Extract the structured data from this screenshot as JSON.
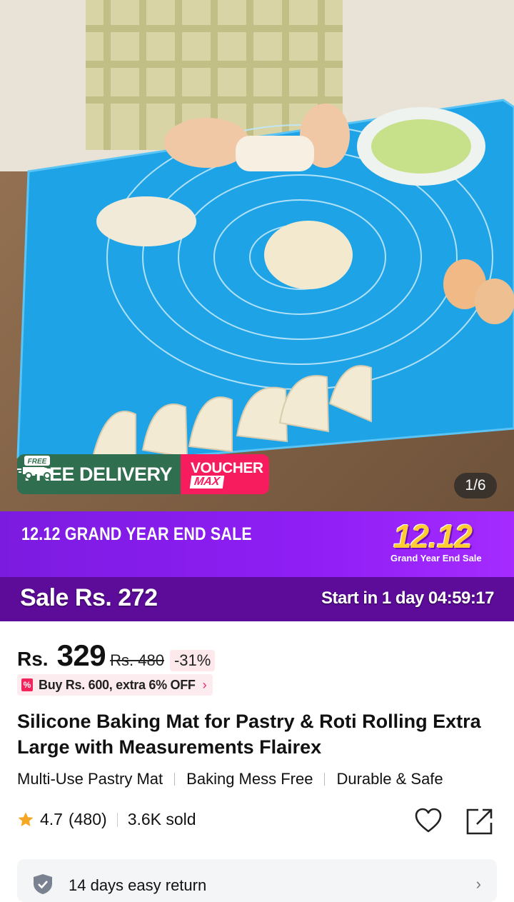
{
  "gallery": {
    "counter": "1/6",
    "badges": {
      "free_small": "FREE",
      "free_delivery": "FREE DELIVERY",
      "voucher_top": "VOUCHER",
      "voucher_bottom": "MAX"
    }
  },
  "campaign": {
    "title": "12.12 GRAND YEAR END SALE",
    "logo_big": "12.12",
    "logo_small": "Grand Year End Sale"
  },
  "sale": {
    "price_text": "Sale Rs. 272",
    "countdown_text": "Start in 1 day 04:59:17"
  },
  "price": {
    "currency": "Rs.",
    "amount": "329",
    "original": "Rs. 480",
    "discount": "-31%"
  },
  "promo": {
    "text": "Buy Rs. 600, extra 6% OFF",
    "chevron": "›"
  },
  "product": {
    "title": "Silicone Baking Mat for Pastry & Roti Rolling Extra Large with Measurements Flairex",
    "features": [
      "Multi-Use Pastry Mat",
      "Baking Mess Free",
      "Durable & Safe"
    ],
    "rating": "4.7",
    "reviews": "(480)",
    "sold": "3.6K sold"
  },
  "return_policy": {
    "text": "14 days easy return",
    "chevron": "›"
  },
  "icons": {
    "star": "star-icon",
    "heart": "heart-icon",
    "share": "share-icon",
    "shield": "shield-icon",
    "truck": "truck-icon"
  },
  "colors": {
    "campaign_purple": "#8f1ef5",
    "sale_bar": "#5d0c9a",
    "free_delivery_green": "#2f6e4e",
    "voucher_pink": "#f71c5d",
    "star_gold": "#f5a623"
  }
}
